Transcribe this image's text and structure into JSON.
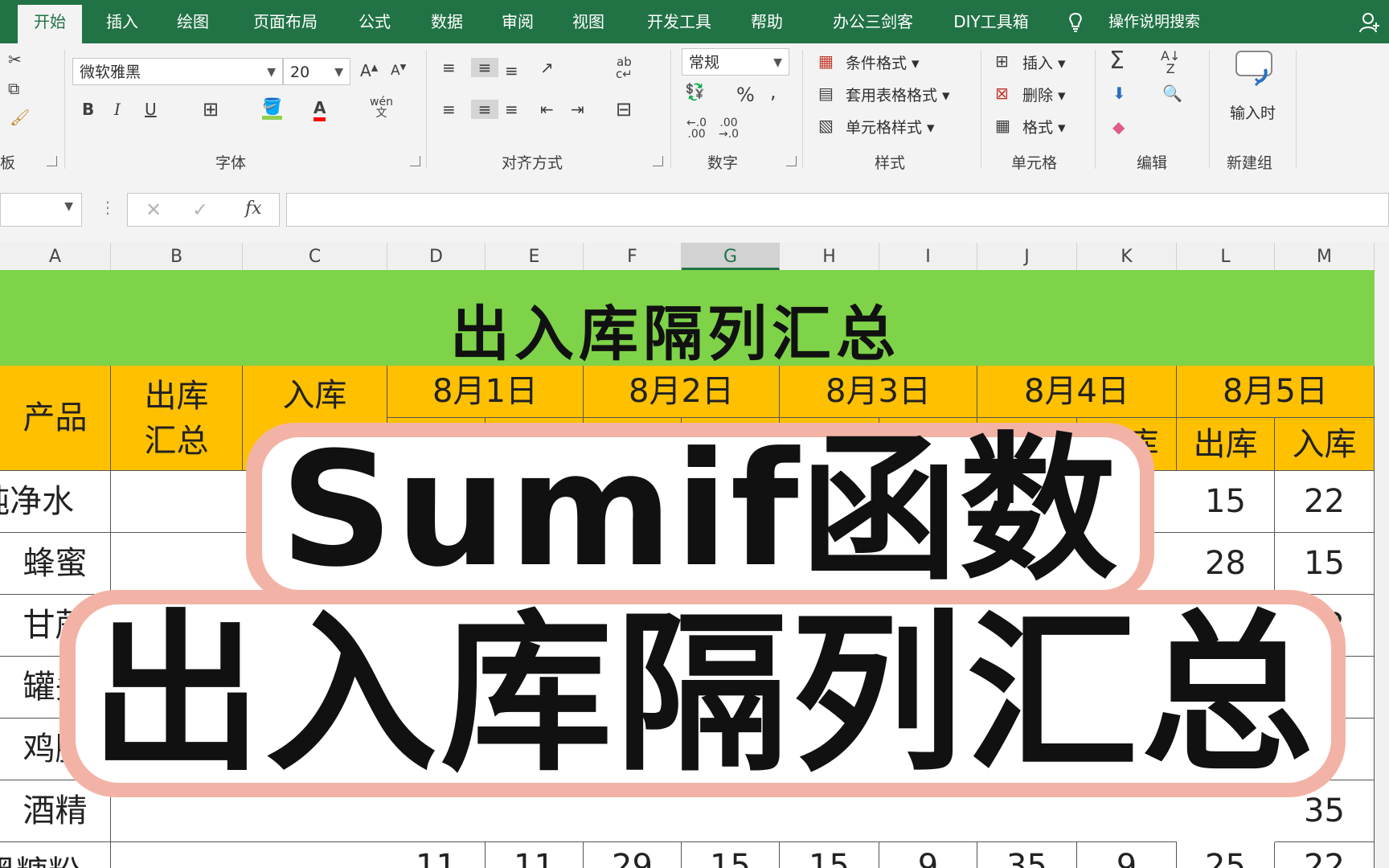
{
  "tabs": [
    "开始",
    "插入",
    "绘图",
    "页面布局",
    "公式",
    "数据",
    "审阅",
    "视图",
    "开发工具",
    "帮助",
    "办公三剑客",
    "DIY工具箱"
  ],
  "tell_me": "操作说明搜索",
  "ribbon": {
    "clipboard_label": "板",
    "font_label": "字体",
    "align_label": "对齐方式",
    "number_label": "数字",
    "styles_label": "样式",
    "cells_label": "单元格",
    "editing_label": "编辑",
    "newgroup_label": "新建组",
    "font_name": "微软雅黑",
    "font_size": "20",
    "number_format": "常规",
    "conditional_format": "条件格式",
    "table_format": "套用表格格式",
    "cell_styles": "单元格样式",
    "insert": "插入",
    "delete": "删除",
    "format": "格式",
    "input_time": "输入时"
  },
  "columns": [
    "A",
    "B",
    "C",
    "D",
    "E",
    "F",
    "G",
    "H",
    "I",
    "J",
    "K",
    "L",
    "M"
  ],
  "selected_column": "G",
  "sheet": {
    "title": "出入库隔列汇总",
    "h_product": "产品",
    "h_out_total": "出库汇总",
    "h_in_total": "入库",
    "dates": [
      "8月1日",
      "8月2日",
      "8月3日",
      "8月4日",
      "8月5日"
    ],
    "out_label": "出库",
    "in_label": "入库",
    "products": [
      "纯净水",
      "蜂蜜",
      "甘蔗",
      "罐头",
      "鸡腿",
      "酒精",
      "黑糖粉"
    ],
    "visible_values": [
      [
        "15",
        "22"
      ],
      [
        "28",
        "15"
      ],
      [
        "",
        "22"
      ],
      [
        "",
        "15"
      ],
      [
        "",
        ""
      ],
      [
        "",
        "35"
      ],
      [
        "25",
        "22"
      ]
    ],
    "last_row_values": [
      "11",
      "11",
      "29",
      "15",
      "15",
      "9",
      "35",
      "9"
    ]
  },
  "overlay": {
    "line1": "Sumif函数",
    "line2": "出入库隔列汇总"
  },
  "colors": {
    "excel_green": "#217346",
    "title_green": "#7ed348",
    "header_gold": "#ffc000",
    "overlay_halo": "#f2b3a6"
  }
}
